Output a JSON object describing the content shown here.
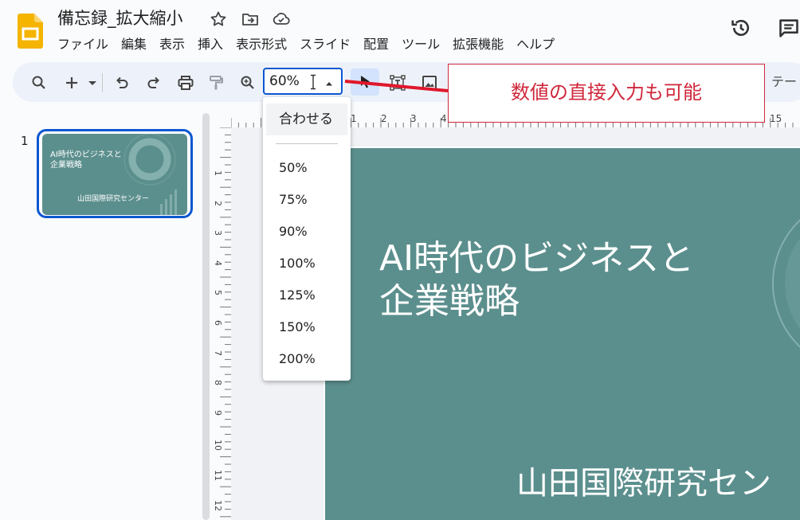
{
  "app": {
    "doc_title": "備忘録_拡大縮小",
    "brand_color": "#f4b400"
  },
  "menubar": {
    "items": [
      "ファイル",
      "編集",
      "表示",
      "挿入",
      "表示形式",
      "スライド",
      "配置",
      "ツール",
      "拡張機能",
      "ヘルプ"
    ]
  },
  "toolbar": {
    "zoom_value": "60%",
    "theme_label": "テー",
    "accent": "#0b57d0"
  },
  "zoom_menu": {
    "fit_label": "合わせる",
    "options": [
      "50%",
      "75%",
      "90%",
      "100%",
      "125%",
      "150%",
      "200%"
    ]
  },
  "callout": {
    "text": "数値の直接入力も可能",
    "color": "#d0283c"
  },
  "slides_panel": {
    "slide_number": "1",
    "thumb_title": "AI時代のビジネスと\n企業戦略",
    "thumb_subtitle": "山田国際研究センター"
  },
  "ruler": {
    "horizontal_ticks": [
      "1",
      "1",
      "2",
      "3",
      "4",
      "15"
    ],
    "vertical_ticks": [
      "1",
      "2",
      "3",
      "4",
      "5",
      "6",
      "7",
      "8",
      "9",
      "10",
      "11",
      "12"
    ]
  },
  "slide": {
    "title_line1": "AI時代のビジネスと",
    "title_line2": "企業戦略",
    "subtitle": "山田国際研究セン",
    "background": "#5b8f8d"
  }
}
